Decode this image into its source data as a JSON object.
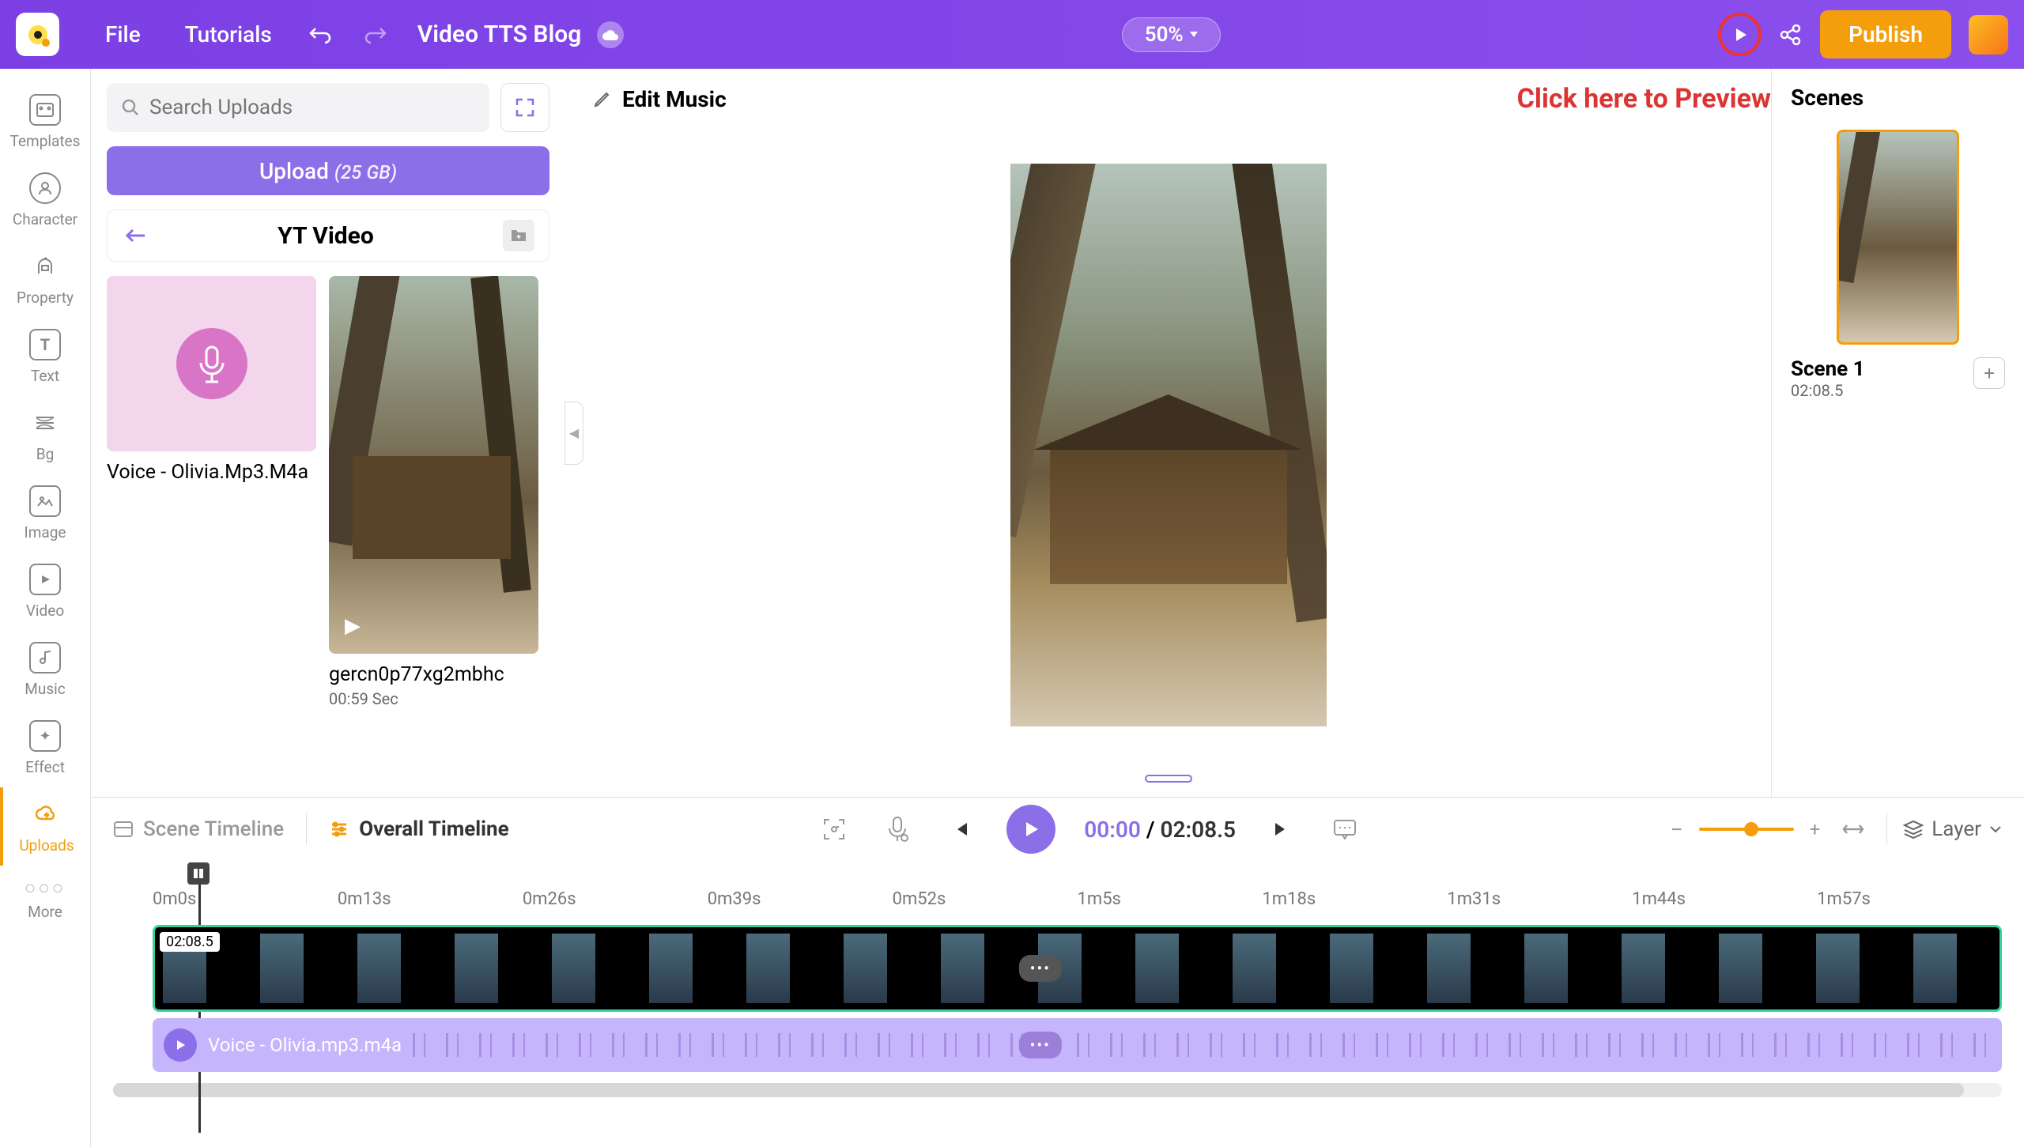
{
  "topbar": {
    "menu": {
      "file": "File",
      "tutorials": "Tutorials"
    },
    "project_title": "Video TTS Blog",
    "zoom": "50%",
    "publish": "Publish"
  },
  "annotation": "Click here to Preview",
  "sidebar": {
    "items": [
      {
        "label": "Templates"
      },
      {
        "label": "Character"
      },
      {
        "label": "Property"
      },
      {
        "label": "Text"
      },
      {
        "label": "Bg"
      },
      {
        "label": "Image"
      },
      {
        "label": "Video"
      },
      {
        "label": "Music"
      },
      {
        "label": "Effect"
      },
      {
        "label": "Uploads"
      },
      {
        "label": "More"
      }
    ]
  },
  "uploads": {
    "search_placeholder": "Search Uploads",
    "upload_button": "Upload",
    "upload_quota": "(25 GB)",
    "folder": "YT Video",
    "assets": [
      {
        "name": "Voice - Olivia.Mp3.M4a"
      },
      {
        "name": "gercn0p77xg2mbhc",
        "duration": "00:59 Sec"
      }
    ]
  },
  "editor": {
    "panel_title": "Edit Music"
  },
  "scenes": {
    "title": "Scenes",
    "items": [
      {
        "name": "Scene 1",
        "duration": "02:08.5"
      }
    ]
  },
  "timeline": {
    "scene_tab": "Scene Timeline",
    "overall_tab": "Overall Timeline",
    "current_time": "00:00",
    "total_time": "02:08.5",
    "layer": "Layer",
    "ruler": [
      "0m0s",
      "0m13s",
      "0m26s",
      "0m39s",
      "0m52s",
      "1m5s",
      "1m18s",
      "1m31s",
      "1m44s",
      "1m57s"
    ],
    "video_clip_duration": "02:08.5",
    "audio_clip_name": "Voice - Olivia.mp3.m4a"
  }
}
